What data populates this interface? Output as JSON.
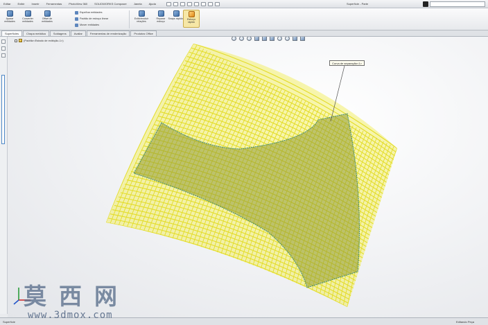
{
  "menubar": {
    "items": [
      "Editar",
      "Exibir",
      "Inserir",
      "Ferramentas",
      "PhotoView 360",
      "SOLIDWORKS Composer",
      "Janela",
      "Ajuda"
    ],
    "doc_title": "Superfície - Parte",
    "search_value": ""
  },
  "ribbon": {
    "buttons": [
      {
        "label": "Aparar entidades",
        "icon": "trim-icon"
      },
      {
        "label": "Converter entidades",
        "icon": "convert-icon"
      },
      {
        "label": "Offset de entidades",
        "icon": "offset-icon"
      },
      {
        "label": "Exibir/excluir relações",
        "icon": "relations-icon"
      },
      {
        "label": "Reparar esboço",
        "icon": "repair-icon"
      },
      {
        "label": "Snaps rápidos",
        "icon": "snap-icon"
      },
      {
        "label": "Esboço rápido",
        "icon": "rapid-sketch-icon"
      }
    ],
    "rows": [
      "Espelhar entidades",
      "Padrão de esboço linear",
      "Mover entidades"
    ]
  },
  "tabs": [
    "Superfícies",
    "Chapa metálica",
    "Soldagens",
    "Avaliar",
    "Ferramentas de renderização",
    "Produtos Office"
  ],
  "active_tab": 0,
  "tree": {
    "root_label": "(Padrão<Estado de exibição-1>)"
  },
  "callout": {
    "label": "Curva de separação<1>"
  },
  "statusbar": {
    "left": "Superfície",
    "right": "Editando Peça"
  },
  "watermark": {
    "chinese": "莫西网",
    "url": "www.3dmox.com"
  },
  "colors": {
    "surface_fill": "#f2ef6a",
    "grid_line": "#e3dc27",
    "trim_region": "#7f8c2f",
    "trim_edge": "#3d8a7d",
    "background": "#f3f4f6"
  }
}
